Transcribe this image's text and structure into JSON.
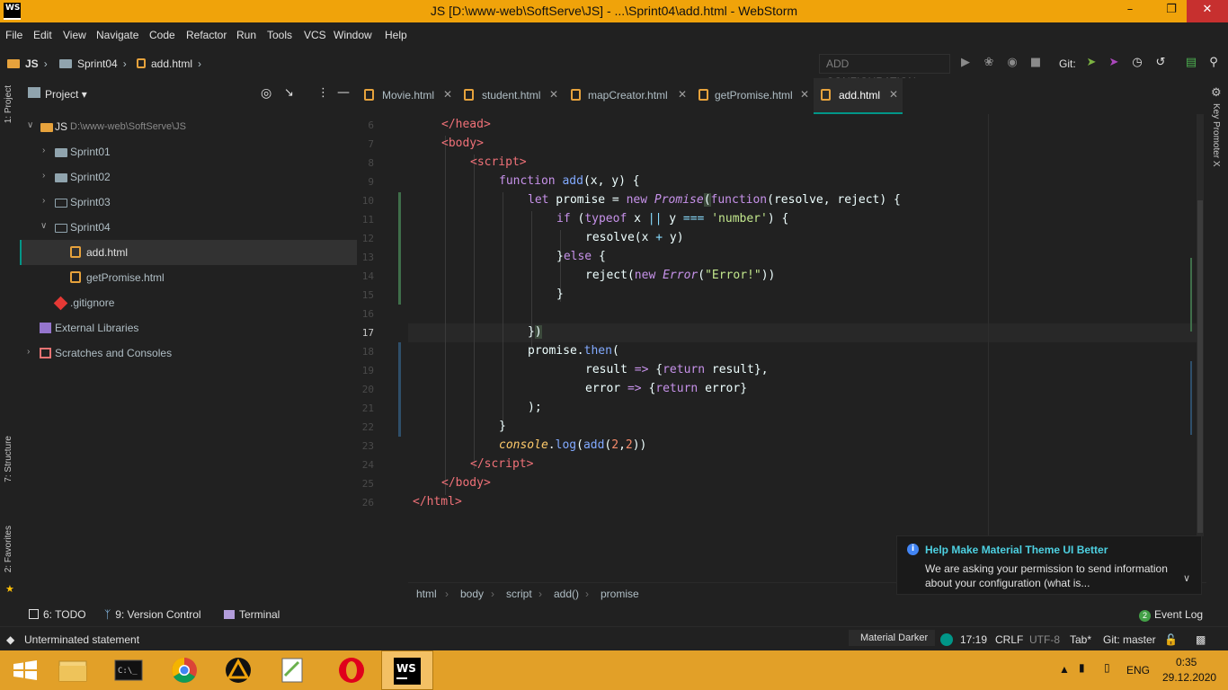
{
  "window": {
    "title": "JS [D:\\www-web\\SoftServe\\JS] - ...\\Sprint04\\add.html - WebStorm",
    "app_logo": "WS",
    "controls": [
      "minimize-icon",
      "restore-icon",
      "close-icon"
    ]
  },
  "menu": [
    "File",
    "Edit",
    "View",
    "Navigate",
    "Code",
    "Refactor",
    "Run",
    "Tools",
    "VCS",
    "Window",
    "Help"
  ],
  "nav": {
    "crumbs": [
      "JS",
      "Sprint04",
      "add.html"
    ],
    "add_config": "ADD CONFIGURATION...",
    "git_label": "Git:"
  },
  "left_stripe": {
    "project": "1: Project",
    "structure": "7: Structure",
    "favorites": "2: Favorites"
  },
  "right_stripe": {
    "key_promoter": "Key Promoter X"
  },
  "project": {
    "title": "Project",
    "tree": [
      {
        "label": "JS",
        "path": "D:\\www-web\\SoftServe\\JS",
        "kind": "module",
        "expanded": true
      },
      {
        "label": "Sprint01",
        "kind": "folder",
        "expanded": false
      },
      {
        "label": "Sprint02",
        "kind": "folder",
        "expanded": false
      },
      {
        "label": "Sprint03",
        "kind": "folder",
        "expanded": false
      },
      {
        "label": "Sprint04",
        "kind": "folder",
        "expanded": true
      },
      {
        "label": "add.html",
        "kind": "html",
        "selected": true
      },
      {
        "label": "getPromise.html",
        "kind": "html"
      },
      {
        "label": ".gitignore",
        "kind": "git"
      },
      {
        "label": "External Libraries",
        "kind": "lib"
      },
      {
        "label": "Scratches and Consoles",
        "kind": "scratch"
      }
    ]
  },
  "tabs": [
    "Movie.html",
    "student.html",
    "mapCreator.html",
    "getPromise.html",
    "add.html"
  ],
  "active_tab": "add.html",
  "editor": {
    "line_numbers": [
      "6",
      "7",
      "8",
      "9",
      "10",
      "11",
      "12",
      "13",
      "14",
      "15",
      "16",
      "17",
      "18",
      "19",
      "20",
      "21",
      "22",
      "23",
      "24",
      "25",
      "26"
    ],
    "current_line": "17",
    "breadcrumbs": [
      "html",
      "body",
      "script",
      "add()",
      "promise"
    ]
  },
  "notification": {
    "title": "Help Make Material Theme UI Better",
    "body": "We are asking your permission to send information about your configuration (what is..."
  },
  "bottom_tools": [
    "6: TODO",
    "9: Version Control",
    "Terminal"
  ],
  "event_log": {
    "count": "2",
    "label": "Event Log"
  },
  "status": {
    "message": "Unterminated statement",
    "theme": "Material Darker",
    "position": "17:19",
    "line_sep": "CRLF",
    "encoding": "UTF-8",
    "indent": "Tab*",
    "branch": "Git: master"
  },
  "taskbar": {
    "lang": "ENG",
    "time": "0:35",
    "date": "29.12.2020"
  },
  "colors": {
    "accent": "#009688",
    "titlebar": "#f0a30a",
    "background": "#212121"
  }
}
